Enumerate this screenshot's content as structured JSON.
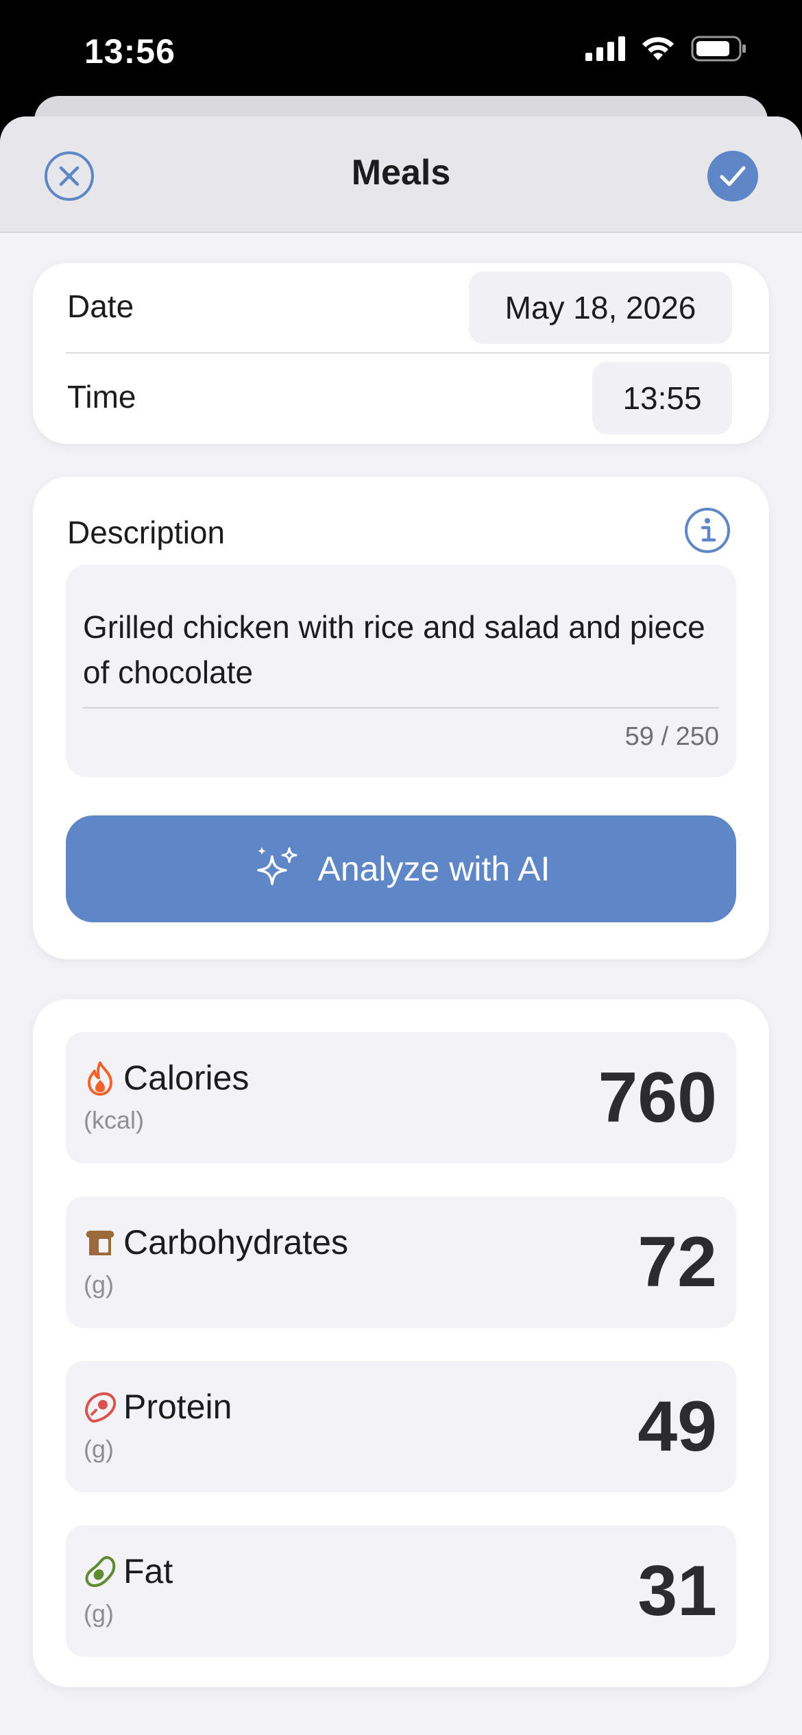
{
  "status_bar": {
    "time": "13:56"
  },
  "nav": {
    "title": "Meals"
  },
  "datetime": {
    "date_label": "Date",
    "date_value": "May 18, 2026",
    "time_label": "Time",
    "time_value": "13:55"
  },
  "description": {
    "label": "Description",
    "text": "Grilled chicken with rice and salad and piece of chocolate",
    "counter": "59 / 250",
    "ai_button_label": "Analyze with AI"
  },
  "nutrition": {
    "items": [
      {
        "label": "Calories",
        "unit": "(kcal)",
        "value": "760",
        "icon": "flame-icon",
        "color": "#f2622a"
      },
      {
        "label": "Carbohydrates",
        "unit": "(g)",
        "value": "72",
        "icon": "bread-icon",
        "color": "#9c6a3a"
      },
      {
        "label": "Protein",
        "unit": "(g)",
        "value": "49",
        "icon": "steak-icon",
        "color": "#d9534f"
      },
      {
        "label": "Fat",
        "unit": "(g)",
        "value": "31",
        "icon": "avocado-icon",
        "color": "#5f8a30"
      }
    ]
  },
  "colors": {
    "accent": "#5f86c6",
    "background": "#f2f2f7",
    "card": "#ffffff"
  }
}
